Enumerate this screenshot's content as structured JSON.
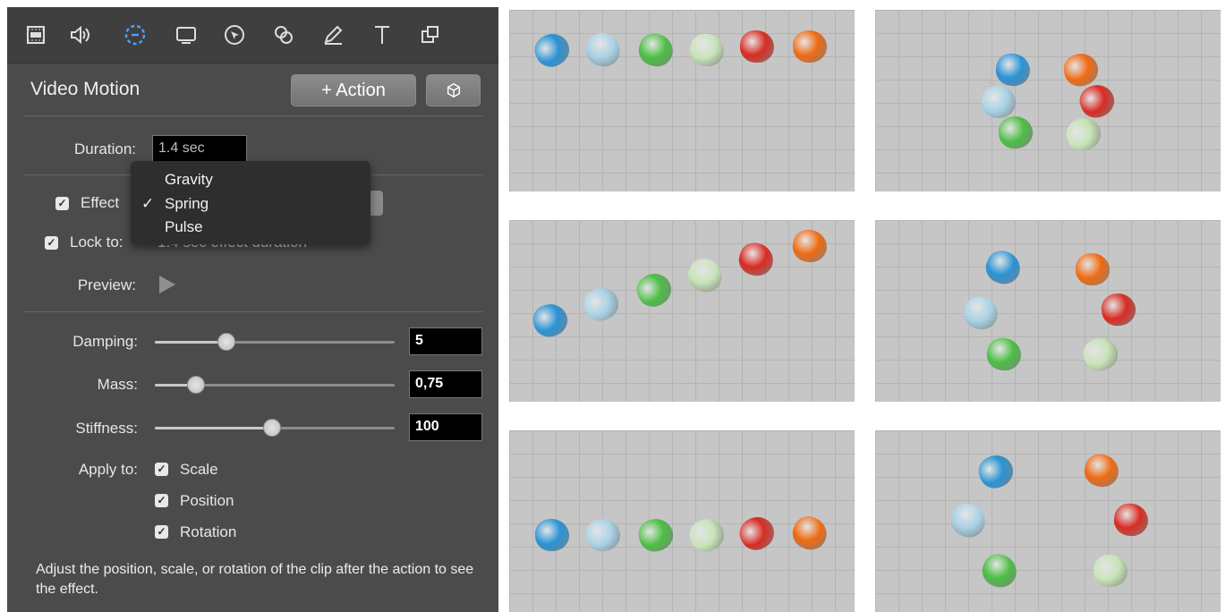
{
  "toolbar": {
    "icons": [
      "film-icon",
      "speaker-icon",
      "motion-icon",
      "screen-icon",
      "cursor-icon",
      "circles-icon",
      "pencil-icon",
      "text-icon",
      "transform-icon"
    ],
    "active": "motion-icon"
  },
  "inspector": {
    "title": "Video Motion",
    "add_action_label": "+ Action",
    "duration_label": "Duration:",
    "duration_value": "1.4 sec",
    "effect_label": "Effect",
    "lock_label": "Lock to:",
    "lock_value": "1.4 sec effect duration",
    "preview_label": "Preview:",
    "effect_menu": {
      "options": [
        "Gravity",
        "Spring",
        "Pulse"
      ],
      "selected": "Spring"
    },
    "damping": {
      "label": "Damping:",
      "value": "5",
      "level": 0.3
    },
    "mass": {
      "label": "Mass:",
      "value": "0,75",
      "level": 0.17
    },
    "stiffness": {
      "label": "Stiffness:",
      "value": "100",
      "level": 0.49
    },
    "apply_to_label": "Apply to:",
    "apply_to": [
      "Scale",
      "Position",
      "Rotation"
    ],
    "help_text": "Adjust the position, scale, or rotation of the clip after the action to see the effect."
  },
  "colors": {
    "blue": "#2a93d6",
    "light_blue": "#a9d3e6",
    "green": "#4cbf45",
    "light_green": "#c8e4b8",
    "red": "#d92b22",
    "orange": "#f06a12"
  }
}
